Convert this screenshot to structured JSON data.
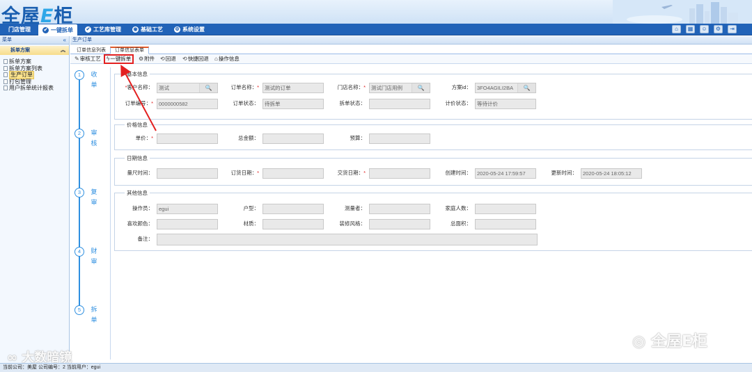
{
  "header": {
    "logo_main": "全屋",
    "logo_e": "E",
    "logo_tail": "柜"
  },
  "nav": {
    "items": [
      {
        "label": "门店管理",
        "icon": ""
      },
      {
        "label": "一键拆单",
        "icon": "✔"
      },
      {
        "label": "工艺库管理",
        "icon": "✔"
      },
      {
        "label": "基础工艺",
        "icon": "◉"
      },
      {
        "label": "系统设置",
        "icon": "⚙"
      }
    ]
  },
  "sidebar": {
    "title": "菜单",
    "collapse": "«",
    "group": "拆单方案",
    "group_arrow": "︽",
    "items": [
      "拆单方案",
      "拆单方案列表",
      "生产订单",
      "打包管理",
      "用户拆单统计报表"
    ]
  },
  "main": {
    "breadcrumb": "生产订单",
    "tabs": [
      "订单信息列表",
      "订单信息表单"
    ],
    "toolbar": [
      "审核工艺",
      "一键拆单",
      "附件",
      "回退",
      "快捷回退",
      "操作信息"
    ]
  },
  "steps": [
    {
      "num": "1",
      "label": "收单"
    },
    {
      "num": "2",
      "label": "审核"
    },
    {
      "num": "3",
      "label": "复审"
    },
    {
      "num": "4",
      "label": "财审"
    },
    {
      "num": "5",
      "label": "拆单"
    }
  ],
  "form": {
    "basic": {
      "legend": "基本信息",
      "customer_name_label": "客户名称：",
      "customer_name": "测试",
      "order_name_label": "订单名称：",
      "order_name": "测试的订单",
      "store_name_label": "门店名称：",
      "store_name": "测试门店用例",
      "plan_id_label": "方案id：",
      "plan_id": "3FO4AGILI2BA",
      "order_no_label": "订单编号：",
      "order_no": "0000000582",
      "order_status_label": "订单状态：",
      "order_status": "待拆单",
      "split_status_label": "拆单状态：",
      "split_status": "",
      "price_status_label": "计价状态：",
      "price_status": "等待计价"
    },
    "price": {
      "legend": "价格信息",
      "unit_price_label": "单价：",
      "unit_price": "",
      "total_label": "总金额：",
      "total": "",
      "budget_label": "预算：",
      "budget": ""
    },
    "date": {
      "legend": "日期信息",
      "measure_time_label": "量尺时间：",
      "measure_time": "",
      "order_date_label": "订货日期：",
      "order_date": "",
      "delivery_date_label": "交货日期：",
      "delivery_date": "",
      "created_label": "创建时间：",
      "created": "2020-05-24 17:59:57",
      "updated_label": "更新时间：",
      "updated": "2020-05-24 18:05:12"
    },
    "other": {
      "legend": "其他信息",
      "operator_label": "操作员：",
      "operator": "egui",
      "house_type_label": "户型：",
      "house_type": "",
      "surveyor_label": "测量者：",
      "surveyor": "",
      "family_label": "家庭人数：",
      "family": "",
      "color_label": "喜欢颜色：",
      "color": "",
      "material_label": "材质：",
      "material": "",
      "style_label": "装修风格：",
      "style": "",
      "area_label": "总面积：",
      "area": "",
      "remark_label": "备注：",
      "remark": ""
    }
  },
  "footer": {
    "text": "当前公司：美屋   公司编号：2   当前用户：egui"
  },
  "watermarks": {
    "left": "大数暗镜",
    "right": "全屋E柜"
  },
  "colors": {
    "nav_bg": "#2163b8",
    "accent": "#2e8fe0",
    "highlight_border": "#e32020"
  }
}
